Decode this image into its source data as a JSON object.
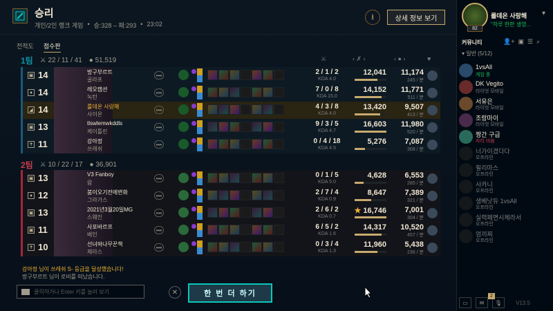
{
  "header": {
    "title": "승리",
    "mode": "개인/2인 랭크 게임",
    "score": "승:328 – 패:293",
    "duration": "23:02",
    "detail_button": "상세 정보 보기"
  },
  "tabs": [
    "전적도",
    "점수판"
  ],
  "columns": {
    "kda_icon": "⚔",
    "dmg_icon": "‹ ✗ ›",
    "gold_icon": "‹ ● ›",
    "ward_icon": "♥"
  },
  "teams": [
    {
      "name": "1팀",
      "kda": "22 / 11 / 41",
      "gold": "51,519",
      "color": "#0a96aa",
      "players": [
        {
          "role": "▣",
          "level": "14",
          "name": "방구부르트",
          "champion": "골라프",
          "kda": "2 / 1 / 2",
          "kda_ratio": "KDA 4.0",
          "damage": "12,041",
          "dmg_pct": 0.72,
          "gold": "11,174",
          "cs": "245 / 분",
          "me": false
        },
        {
          "role": "♦",
          "level": "14",
          "name": "레오캠션",
          "champion": "녹턴",
          "kda": "7 / 0 / 8",
          "kda_ratio": "KDA 15.0",
          "damage": "14,152",
          "dmg_pct": 0.85,
          "gold": "11,771",
          "cs": "511 / 분",
          "me": false
        },
        {
          "role": "◢",
          "level": "14",
          "name": "룰데온 사랑해",
          "champion": "사이온",
          "kda": "4 / 3 / 8",
          "kda_ratio": "KDA 4.0",
          "damage": "13,420",
          "dmg_pct": 0.8,
          "gold": "9,507",
          "cs": "413 / 분",
          "me": true
        },
        {
          "role": "▣",
          "level": "13",
          "name": "tlswlemwkddls",
          "champion": "케이틀린",
          "kda": "9 / 3 / 5",
          "kda_ratio": "KDA 4.7",
          "damage": "16,603",
          "dmg_pct": 1.0,
          "gold": "11,980",
          "cs": "520 / 분",
          "me": false
        },
        {
          "role": "✝",
          "level": "11",
          "name": "강아정",
          "champion": "쓰레쉬",
          "kda": "0 / 4 / 18",
          "kda_ratio": "KDA 4.5",
          "damage": "5,276",
          "dmg_pct": 0.32,
          "gold": "7,087",
          "cs": "308 / 분",
          "me": false
        }
      ]
    },
    {
      "name": "2팀",
      "kda": "10 / 22 / 17",
      "gold": "36,901",
      "color": "#c83c50",
      "players": [
        {
          "role": "▣",
          "level": "13",
          "name": "V3 Fanboy",
          "champion": "람",
          "kda": "0 / 1 / 5",
          "kda_ratio": "KDA 5.0",
          "damage": "4,628",
          "dmg_pct": 0.28,
          "gold": "6,553",
          "cs": "285 / 분",
          "me": false
        },
        {
          "role": "♦",
          "level": "12",
          "name": "붐이오기전에변화",
          "champion": "그라가스",
          "kda": "2 / 7 / 4",
          "kda_ratio": "KDA 0.9",
          "damage": "8,647",
          "dmg_pct": 0.52,
          "gold": "7,389",
          "cs": "321 / 분",
          "me": false
        },
        {
          "role": "▣",
          "level": "13",
          "name": "2021년3월20일MG",
          "champion": "스웨인",
          "kda": "2 / 6 / 2",
          "kda_ratio": "KDA 0.7",
          "damage": "16,746",
          "dmg_pct": 1.0,
          "gold": "7,001",
          "cs": "304 / 분",
          "me": false,
          "star": "★"
        },
        {
          "role": "▣",
          "level": "11",
          "name": "사포바르프",
          "champion": "베인",
          "kda": "6 / 5 / 2",
          "kda_ratio": "KDA 1.6",
          "damage": "14,317",
          "dmg_pct": 0.85,
          "gold": "10,520",
          "cs": "457 / 분",
          "me": false
        },
        {
          "role": "✝",
          "level": "10",
          "name": "선녀와나무꾼책",
          "champion": "제라스",
          "kda": "0 / 3 / 4",
          "kda_ratio": "KDA 1.3",
          "damage": "11,960",
          "dmg_pct": 0.71,
          "gold": "5,438",
          "cs": "236 / 분",
          "me": false
        }
      ]
    }
  ],
  "chat": {
    "line1": "강아정 님이 쓰레쉬 S- 등급을 달성했습니다!",
    "line2": "방구부르트 님이 로비를 떠났습니다.",
    "placeholder": "클릭하거나 Enter 키를 눌러 보기"
  },
  "play_again": "한 번 더 하기",
  "sidebar": {
    "my_name": "룰데온 사랑해",
    "my_level": "82",
    "my_status": "\"하루 한판 생영...",
    "community": "커뮤니티",
    "group": "▾ 일반 (5/12)",
    "friends": [
      {
        "name": "1vsAll",
        "status": "게임 중",
        "state": "on"
      },
      {
        "name": "DK Vegito",
        "status": "라이엇 모바일",
        "state": "mobile"
      },
      {
        "name": "서유은",
        "status": "라이엇 모바일",
        "state": "mobile"
      },
      {
        "name": "조랑마이",
        "status": "라이엇 모바일",
        "state": "mobile"
      },
      {
        "name": "짱간 구급",
        "status": "자리 비움",
        "state": "away"
      },
      {
        "name": "너가이겼다다",
        "status": "오프라인",
        "state": "off"
      },
      {
        "name": "필리마스",
        "status": "오프라인",
        "state": "off"
      },
      {
        "name": "사카니",
        "status": "오프라인",
        "state": "off"
      },
      {
        "name": "생베낫듀 1vsAll",
        "status": "오프라인",
        "state": "off"
      },
      {
        "name": "실력페면시체라서",
        "status": "오프라인",
        "state": "off"
      },
      {
        "name": "엄끼찌",
        "status": "오프라인",
        "state": "off"
      }
    ],
    "mail_count": "2",
    "version": "V13.5"
  }
}
